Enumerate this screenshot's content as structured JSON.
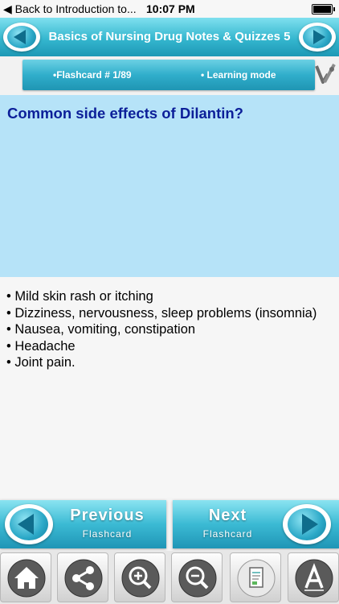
{
  "status_bar": {
    "back": "◀ Back to Introduction to...",
    "time": "10:07 PM"
  },
  "header": {
    "title": "Basics of Nursing Drug Notes & Quizzes 5"
  },
  "info_bar": {
    "flashcard": "•Flashcard #  1/89",
    "mode": "• Learning mode"
  },
  "question": {
    "text": "Common side effects of Dilantin?"
  },
  "answer": {
    "items": [
      "• Mild skin rash or itching",
      "• Dizziness, nervousness, sleep problems (insomnia)",
      "• Nausea, vomiting, constipation",
      "• Headache",
      "• Joint pain."
    ]
  },
  "nav": {
    "previous": {
      "main": "Previous",
      "sub": "Flashcard"
    },
    "next": {
      "main": "Next",
      "sub": "Flashcard"
    }
  },
  "toolbar": {
    "icons": [
      "home-icon",
      "share-icon",
      "zoom-in-icon",
      "zoom-out-icon",
      "document-icon",
      "font-icon"
    ]
  },
  "colors": {
    "accent": "#35b7cf",
    "question_bg": "#b6e3f8",
    "question_text": "#0c1f99"
  }
}
